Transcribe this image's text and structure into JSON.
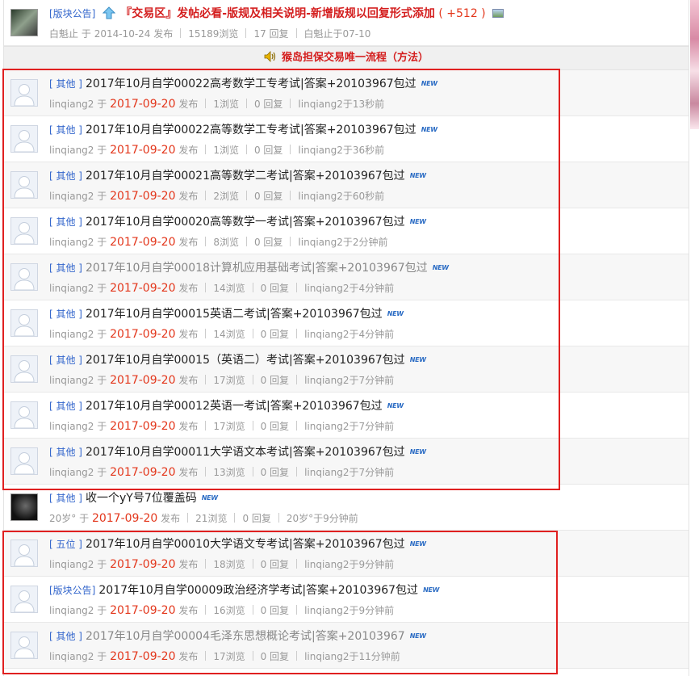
{
  "announcement": {
    "tag": "[版块公告]",
    "title": "『交易区』发帖必看-版规及相关说明-新增版规以回复形式添加",
    "count": "( +512 )",
    "meta_author": "白魁止",
    "meta_date": "2014-10-24 发布",
    "meta_views": "15189浏览",
    "meta_replies": "17 回复",
    "meta_last": "白魁止于07-10"
  },
  "banner": {
    "text": "猴岛担保交易唯一流程（方法）"
  },
  "new_badge": "NEW",
  "posts": [
    {
      "tag": "[ 其他 ]",
      "title": "2017年10月自学00022高考数学工专考试|答案+20103967包过",
      "author": "linqiang2",
      "date": "2017-09-20",
      "views": "1浏览",
      "replies": "0 回复",
      "last": "linqiang2于13秒前",
      "new": true,
      "grey": false
    },
    {
      "tag": "[ 其他 ]",
      "title": "2017年10月自学00022高等数学工专考试|答案+20103967包过",
      "author": "linqiang2",
      "date": "2017-09-20",
      "views": "1浏览",
      "replies": "0 回复",
      "last": "linqiang2于36秒前",
      "new": true,
      "grey": false
    },
    {
      "tag": "[ 其他 ]",
      "title": "2017年10月自学00021高等数学二考试|答案+20103967包过",
      "author": "linqiang2",
      "date": "2017-09-20",
      "views": "2浏览",
      "replies": "0 回复",
      "last": "linqiang2于60秒前",
      "new": true,
      "grey": false
    },
    {
      "tag": "[ 其他 ]",
      "title": "2017年10月自学00020高等数学一考试|答案+20103967包过",
      "author": "linqiang2",
      "date": "2017-09-20",
      "views": "8浏览",
      "replies": "0 回复",
      "last": "linqiang2于2分钟前",
      "new": true,
      "grey": false
    },
    {
      "tag": "[ 其他 ]",
      "title": "2017年10月自学00018计算机应用基础考试|答案+20103967包过",
      "author": "linqiang2",
      "date": "2017-09-20",
      "views": "14浏览",
      "replies": "0 回复",
      "last": "linqiang2于4分钟前",
      "new": true,
      "grey": true
    },
    {
      "tag": "[ 其他 ]",
      "title": "2017年10月自学00015英语二考试|答案+20103967包过",
      "author": "linqiang2",
      "date": "2017-09-20",
      "views": "14浏览",
      "replies": "0 回复",
      "last": "linqiang2于4分钟前",
      "new": true,
      "grey": false
    },
    {
      "tag": "[ 其他 ]",
      "title": "2017年10月自学00015（英语二）考试|答案+20103967包过",
      "author": "linqiang2",
      "date": "2017-09-20",
      "views": "17浏览",
      "replies": "0 回复",
      "last": "linqiang2于7分钟前",
      "new": true,
      "grey": false
    },
    {
      "tag": "[ 其他 ]",
      "title": "2017年10月自学00012英语一考试|答案+20103967包过",
      "author": "linqiang2",
      "date": "2017-09-20",
      "views": "17浏览",
      "replies": "0 回复",
      "last": "linqiang2于7分钟前",
      "new": true,
      "grey": false
    },
    {
      "tag": "[ 其他 ]",
      "title": "2017年10月自学00011大学语文本考试|答案+20103967包过",
      "author": "linqiang2",
      "date": "2017-09-20",
      "views": "13浏览",
      "replies": "0 回复",
      "last": "linqiang2于7分钟前",
      "new": true,
      "grey": false
    },
    {
      "tag": "[ 其他 ]",
      "title": "收一个yY号7位覆盖码",
      "author": "20岁°",
      "date": "2017-09-20",
      "views": "21浏览",
      "replies": "0 回复",
      "last": "20岁°于9分钟前",
      "new": true,
      "grey": false,
      "photo": true
    },
    {
      "tag": "[ 五位 ]",
      "title": "2017年10月自学00010大学语文专考试|答案+20103967包过",
      "author": "linqiang2",
      "date": "2017-09-20",
      "views": "18浏览",
      "replies": "0 回复",
      "last": "linqiang2于9分钟前",
      "new": true,
      "grey": false
    },
    {
      "tag": "[版块公告]",
      "title": "2017年10月自学00009政治经济学考试|答案+20103967包过",
      "author": "linqiang2",
      "date": "2017-09-20",
      "views": "16浏览",
      "replies": "0 回复",
      "last": "linqiang2于9分钟前",
      "new": true,
      "grey": false
    },
    {
      "tag": "[ 其他 ]",
      "title": "2017年10月自学00004毛泽东思想概论考试|答案+20103967",
      "author": "linqiang2",
      "date": "2017-09-20",
      "views": "17浏览",
      "replies": "0 回复",
      "last": "linqiang2于11分钟前",
      "new": true,
      "grey": true
    }
  ],
  "meta_joiner": "于",
  "meta_publish": "发布",
  "colors": {
    "accent_red": "#e3361b",
    "link_blue": "#3366cc",
    "box_red": "#e02020"
  }
}
